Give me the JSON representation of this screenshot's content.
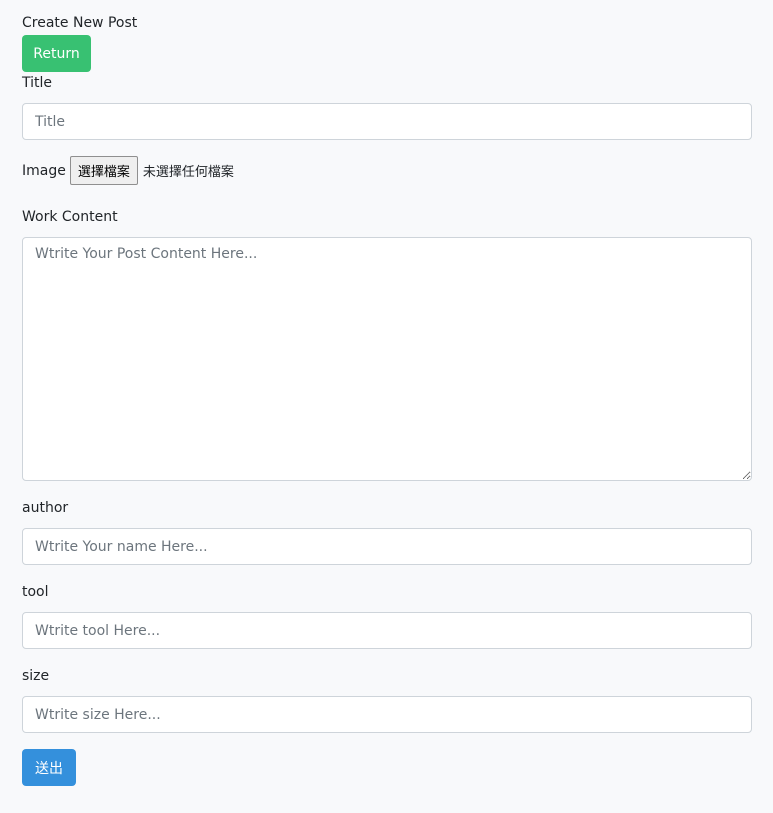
{
  "page": {
    "heading": "Create New Post"
  },
  "return_button": {
    "label": "Return"
  },
  "title_field": {
    "label": "Title",
    "placeholder": "Title",
    "value": ""
  },
  "image_field": {
    "label": "Image",
    "button_label": "選擇檔案",
    "status": "未選擇任何檔案"
  },
  "content_field": {
    "label": "Work Content",
    "placeholder": "Wtrite Your Post Content Here...",
    "value": ""
  },
  "author_field": {
    "label": "author",
    "placeholder": "Wtrite Your name Here...",
    "value": ""
  },
  "tool_field": {
    "label": "tool",
    "placeholder": "Wtrite tool Here...",
    "value": ""
  },
  "size_field": {
    "label": "size",
    "placeholder": "Wtrite size Here...",
    "value": ""
  },
  "submit_button": {
    "label": "送出"
  },
  "colors": {
    "return": "#38c172",
    "submit": "#3490dc",
    "background": "#f8f9fb"
  }
}
